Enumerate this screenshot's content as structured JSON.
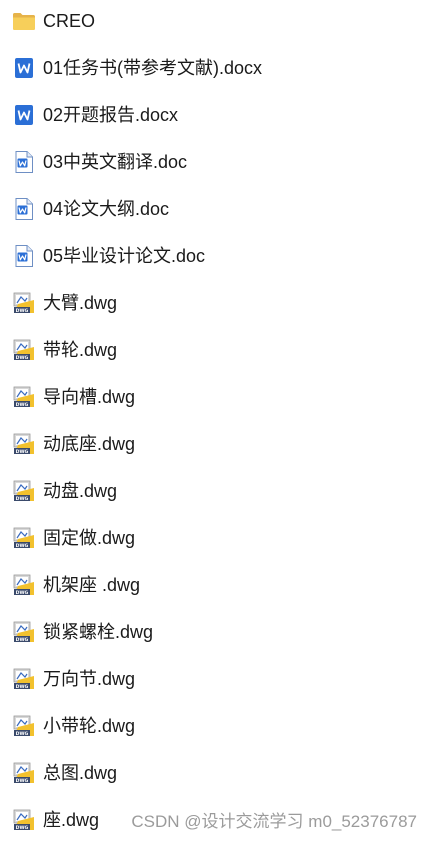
{
  "files": [
    {
      "name": "CREO",
      "type": "folder"
    },
    {
      "name": "01任务书(带参考文献).docx",
      "type": "docx"
    },
    {
      "name": "02开题报告.docx",
      "type": "docx"
    },
    {
      "name": "03中英文翻译.doc",
      "type": "doc"
    },
    {
      "name": "04论文大纲.doc",
      "type": "doc"
    },
    {
      "name": "05毕业设计论文.doc",
      "type": "doc"
    },
    {
      "name": "大臂.dwg",
      "type": "dwg"
    },
    {
      "name": "带轮.dwg",
      "type": "dwg"
    },
    {
      "name": "导向槽.dwg",
      "type": "dwg"
    },
    {
      "name": "动底座.dwg",
      "type": "dwg"
    },
    {
      "name": "动盘.dwg",
      "type": "dwg"
    },
    {
      "name": "固定做.dwg",
      "type": "dwg"
    },
    {
      "name": "机架座 .dwg",
      "type": "dwg"
    },
    {
      "name": "锁紧螺栓.dwg",
      "type": "dwg"
    },
    {
      "name": "万向节.dwg",
      "type": "dwg"
    },
    {
      "name": "小带轮.dwg",
      "type": "dwg"
    },
    {
      "name": "总图.dwg",
      "type": "dwg"
    },
    {
      "name": "座.dwg",
      "type": "dwg"
    }
  ],
  "icons": {
    "folder": "folder-icon",
    "docx": "word-docx-icon",
    "doc": "word-doc-icon",
    "dwg": "dwg-file-icon"
  },
  "watermark": "CSDN @设计交流学习 m0_52376787"
}
